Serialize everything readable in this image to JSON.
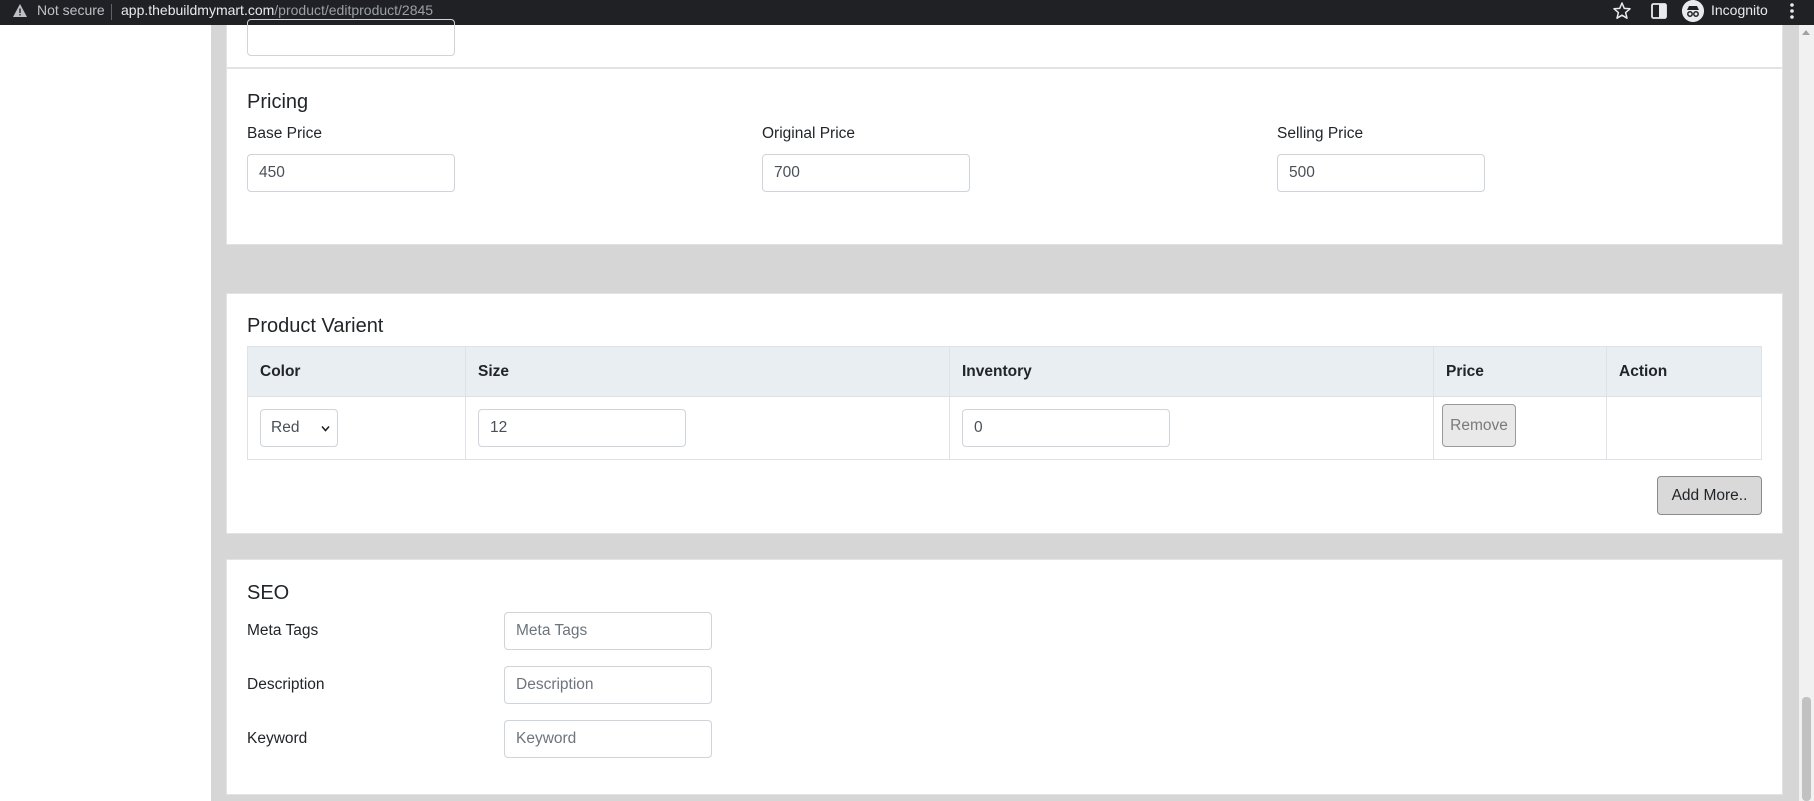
{
  "browser": {
    "security_label": "Not secure",
    "url_host": "app.thebuildmymart.com",
    "url_path": "/product/editproduct/2845",
    "profile_label": "Incognito"
  },
  "pricing": {
    "title": "Pricing",
    "base_price": {
      "label": "Base Price",
      "value": "450"
    },
    "original_price": {
      "label": "Original Price",
      "value": "700"
    },
    "selling_price": {
      "label": "Selling Price",
      "value": "500"
    }
  },
  "variant": {
    "title": "Product Varient",
    "columns": [
      "Color",
      "Size",
      "Inventory",
      "Price",
      "Action"
    ],
    "rows": [
      {
        "color": "Red",
        "size": "12",
        "inventory": "0",
        "action_label": "Remove"
      }
    ],
    "add_more_label": "Add More.."
  },
  "seo": {
    "title": "SEO",
    "meta_tags": {
      "label": "Meta Tags",
      "placeholder": "Meta Tags"
    },
    "description": {
      "label": "Description",
      "placeholder": "Description"
    },
    "keyword": {
      "label": "Keyword",
      "placeholder": "Keyword"
    }
  },
  "colors": {
    "browser_bar": "#202124",
    "page_background": "#d6d6d6",
    "table_header": "#e8eef1"
  }
}
